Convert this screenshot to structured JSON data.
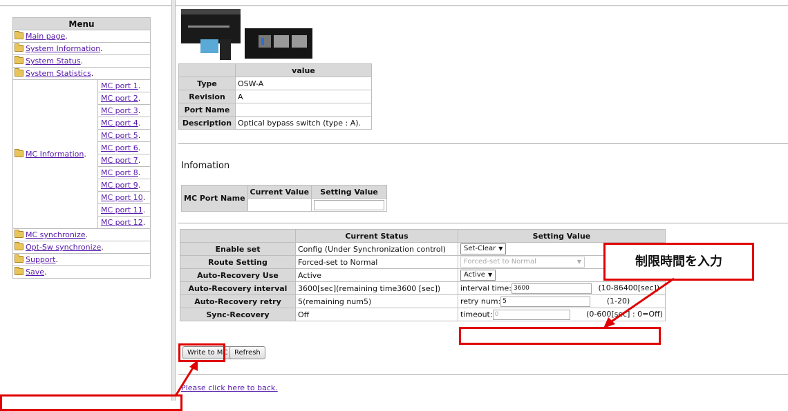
{
  "menu": {
    "title": "Menu",
    "items": [
      "Main page",
      "System Information",
      "System Status",
      "System Statistics"
    ],
    "mc_information": "MC Information",
    "mc_ports": [
      "MC port 1",
      "MC port 2",
      "MC port 3",
      "MC port 4",
      "MC port 5",
      "MC port 6",
      "MC port 7",
      "MC port 8",
      "MC port 9",
      "MC port 10",
      "MC port 11",
      "MC port 12"
    ],
    "bottom_items": [
      "MC synchronize",
      "Opt-Sw synchronize",
      "Support",
      "Save"
    ]
  },
  "module_table": {
    "header": "value",
    "rows": [
      {
        "label": "Type",
        "value": "OSW-A"
      },
      {
        "label": "Revision",
        "value": "A"
      },
      {
        "label": "Port Name",
        "value": ""
      },
      {
        "label": "Description",
        "value": "Optical bypass switch (type : A)."
      }
    ]
  },
  "information": {
    "title": "Infomation",
    "port_name_label": "MC Port Name",
    "current_value_header": "Current Value",
    "setting_value_header": "Setting Value"
  },
  "status_table": {
    "current_status_header": "Current Status",
    "setting_value_header": "Setting Value",
    "enable_set": {
      "label": "Enable set",
      "current": "Config (Under Synchronization control)",
      "setting": "Set-Clear"
    },
    "route_setting": {
      "label": "Route Setting",
      "current": "Forced-set to Normal",
      "setting": "Forced-set to Normal"
    },
    "auto_recovery_use": {
      "label": "Auto-Recovery Use",
      "current": "Active",
      "setting": "Active"
    },
    "auto_recovery_interval": {
      "label": "Auto-Recovery interval",
      "current": "3600[sec](remaining time3600 [sec])",
      "prefix": "interval time:",
      "value": "3600",
      "range": "(10-86400[sec])"
    },
    "auto_recovery_retry": {
      "label": "Auto-Recovery retry",
      "current": "5(remaining num5)",
      "prefix": "retry num:",
      "value": "5",
      "range": "(1-20)"
    },
    "sync_recovery": {
      "label": "Sync-Recovery",
      "current": "Off",
      "prefix": "timeout:",
      "value": "0",
      "range": "(0-600[sec] : 0=Off)"
    }
  },
  "buttons": {
    "write": "Write to MC",
    "refresh": "Refresh"
  },
  "back_link": "Please click here to back.",
  "callout_text": "制限時間を入力",
  "colors": {
    "highlight": "#e00000",
    "header_bg": "#d9d9d9",
    "link": "#5518ab"
  }
}
